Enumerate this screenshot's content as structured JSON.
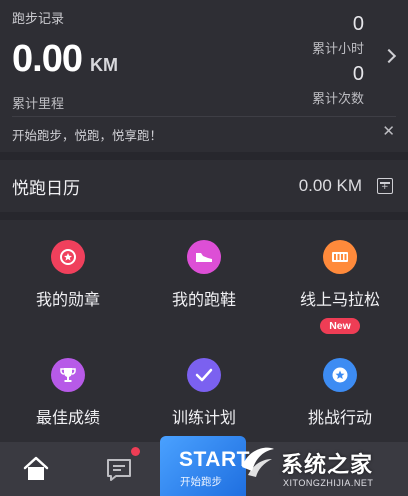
{
  "summary": {
    "title": "跑步记录",
    "distance_value": "0.00",
    "distance_unit": "KM",
    "distance_label": "累计里程",
    "hours_value": "0",
    "hours_label": "累计小时",
    "count_value": "0",
    "count_label": "累计次数",
    "slogan": "开始跑步，悦跑，悦享跑！",
    "close_glyph": "✕"
  },
  "calendar": {
    "title": "悦跑日历",
    "value": "0.00 KM",
    "icon_glyph": "+"
  },
  "grid": {
    "items": [
      {
        "label": "我的勋章",
        "icon": "medal-icon",
        "color": "#f0405c"
      },
      {
        "label": "我的跑鞋",
        "icon": "shoe-icon",
        "color": "#dd4fd6"
      },
      {
        "label": "线上马拉松",
        "icon": "marathon-icon",
        "color": "#ff8a3b",
        "badge": "New"
      },
      {
        "label": "最佳成绩",
        "icon": "trophy-icon",
        "color": "#b75ae8"
      },
      {
        "label": "训练计划",
        "icon": "check-icon",
        "color": "#7b61f0"
      },
      {
        "label": "挑战行动",
        "icon": "star-icon",
        "color": "#3d8cf3"
      }
    ]
  },
  "bottom_nav": {
    "home_icon": "home-icon",
    "message_icon": "message-icon",
    "start_label": "START",
    "start_sublabel": "开始跑步"
  },
  "watermark": {
    "text": "系统之家",
    "url": "XITONGZHIJIA.NET"
  },
  "colors": {
    "background": "#27272d",
    "card": "#2e2e34",
    "accent_blue": "#3d8cf3",
    "badge_red": "#ee3d55"
  }
}
